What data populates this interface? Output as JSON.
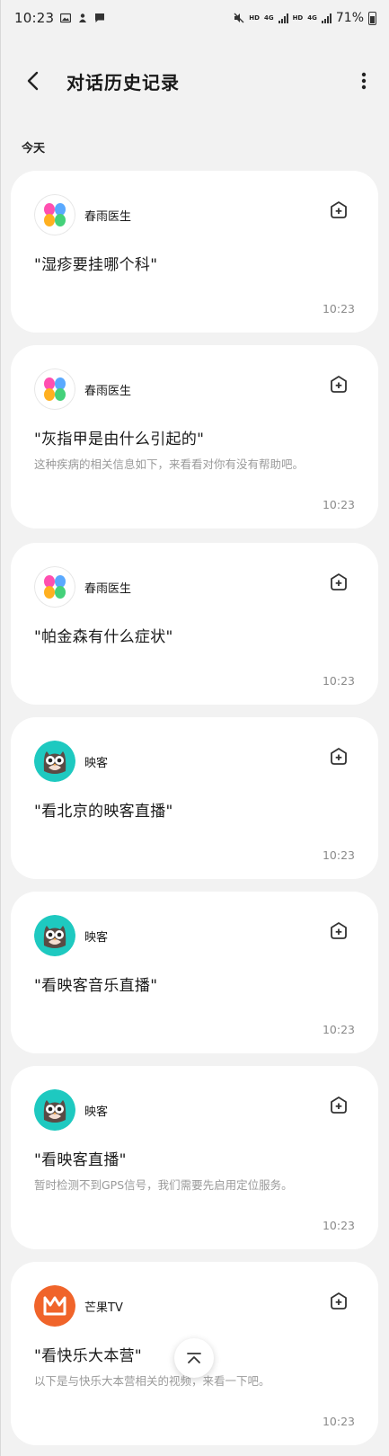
{
  "status_bar": {
    "time": "10:23",
    "hd1": "HD",
    "lte1": "4G",
    "hd2": "HD",
    "lte2": "4G",
    "battery": "71%"
  },
  "header": {
    "title": "对话历史记录"
  },
  "section": {
    "today": "今天"
  },
  "cards": [
    {
      "app": "春雨医生",
      "query": "\"湿疹要挂哪个科\"",
      "subtitle": "",
      "time": "10:23"
    },
    {
      "app": "春雨医生",
      "query": "\"灰指甲是由什么引起的\"",
      "subtitle": "这种疾病的相关信息如下，来看看对你有没有帮助吧。",
      "time": "10:23"
    },
    {
      "app": "春雨医生",
      "query": "\"帕金森有什么症状\"",
      "subtitle": "",
      "time": "10:23"
    },
    {
      "app": "映客",
      "query": "\"看北京的映客直播\"",
      "subtitle": "",
      "time": "10:23"
    },
    {
      "app": "映客",
      "query": "\"看映客音乐直播\"",
      "subtitle": "",
      "time": "10:23"
    },
    {
      "app": "映客",
      "query": "\"看映客直播\"",
      "subtitle": "暂时检测不到GPS信号，我们需要先启用定位服务。",
      "time": "10:23"
    },
    {
      "app": "芒果TV",
      "query": "\"看快乐大本营\"",
      "subtitle": "以下是与快乐大本营相关的视频，来看一下吧。",
      "time": "10:23"
    }
  ],
  "colors": {
    "background": "#f2f2f2",
    "card": "#ffffff",
    "inke_teal": "#1ec9c0",
    "mango_orange": "#f0642a"
  }
}
